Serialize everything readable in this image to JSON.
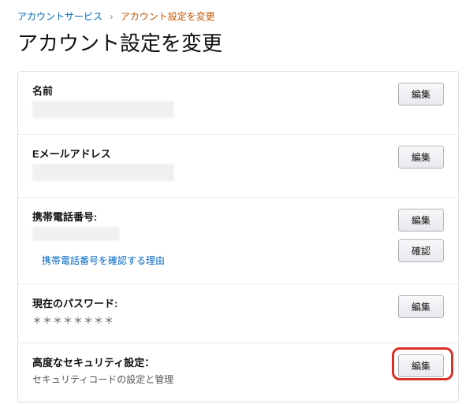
{
  "breadcrumb": {
    "root": "アカウントサービス",
    "sep": "›",
    "current": "アカウント設定を変更"
  },
  "title": "アカウント設定を変更",
  "buttons": {
    "edit": "編集",
    "confirm": "確認"
  },
  "sections": {
    "name": {
      "label": "名前"
    },
    "email": {
      "label": "Eメールアドレス"
    },
    "phone": {
      "label": "携帯電話番号:",
      "why_link": "携帯電話番号を確認する理由"
    },
    "password": {
      "label": "現在のパスワード:",
      "mask": "＊＊＊＊＊＊＊＊"
    },
    "security": {
      "label": "高度なセキュリティ設定：",
      "desc": "セキュリティコードの設定と管理"
    }
  }
}
